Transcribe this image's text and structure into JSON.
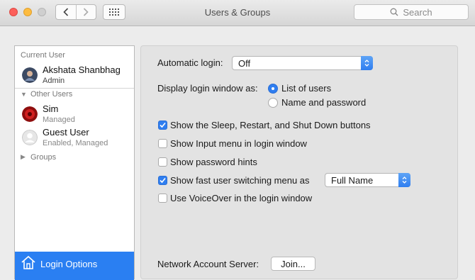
{
  "window": {
    "title": "Users & Groups"
  },
  "toolbar": {
    "search_placeholder": "Search"
  },
  "sidebar": {
    "current_user_header": "Current User",
    "current_user": {
      "name": "Akshata Shanbhag",
      "role": "Admin"
    },
    "other_users_header": "Other Users",
    "other_users": [
      {
        "name": "Sim",
        "status": "Managed"
      },
      {
        "name": "Guest User",
        "status": "Enabled, Managed"
      }
    ],
    "groups_label": "Groups",
    "login_options_label": "Login Options"
  },
  "main": {
    "automatic_login_label": "Automatic login:",
    "automatic_login_value": "Off",
    "display_login_label": "Display login window as:",
    "display_options": [
      {
        "label": "List of users",
        "selected": true
      },
      {
        "label": "Name and password",
        "selected": false
      }
    ],
    "checkboxes": [
      {
        "label": "Show the Sleep, Restart, and Shut Down buttons",
        "checked": true
      },
      {
        "label": "Show Input menu in login window",
        "checked": false
      },
      {
        "label": "Show password hints",
        "checked": false
      },
      {
        "label": "Show fast user switching menu as",
        "checked": true
      },
      {
        "label": "Use VoiceOver in the login window",
        "checked": false
      }
    ],
    "fast_switch_value": "Full Name",
    "network_account_label": "Network Account Server:",
    "join_button": "Join..."
  },
  "colors": {
    "accent": "#2a7ff2"
  }
}
